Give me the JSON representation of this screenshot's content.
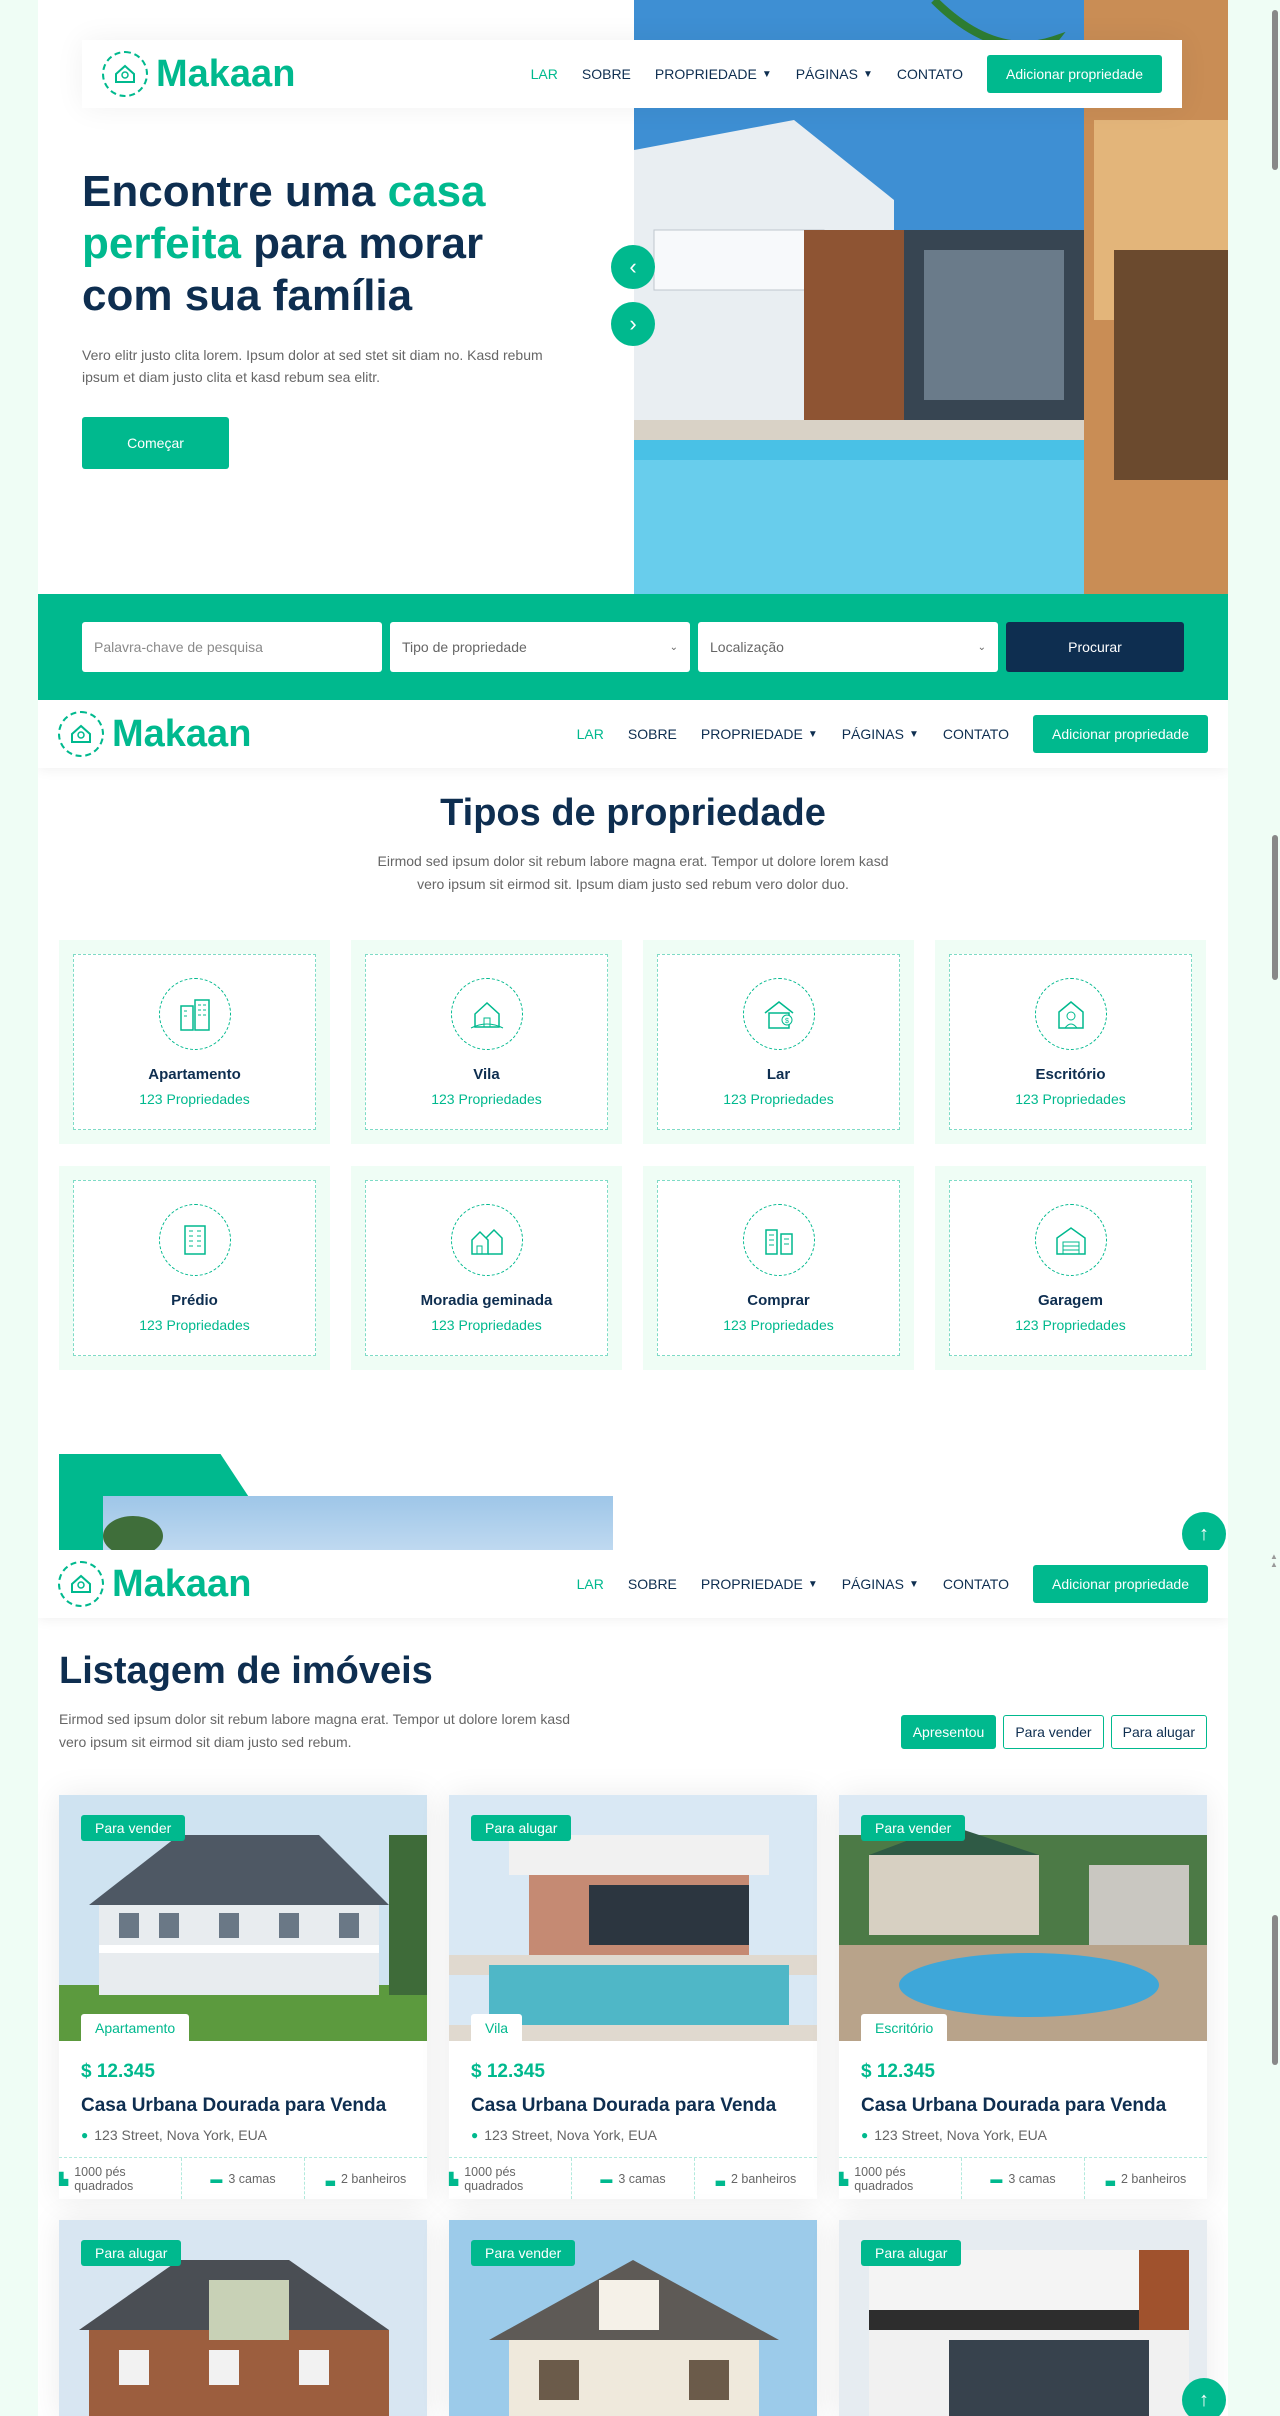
{
  "brand": {
    "name": "Makaan"
  },
  "nav": {
    "items": [
      {
        "label": "LAR"
      },
      {
        "label": "SOBRE"
      },
      {
        "label": "PROPRIEDADE"
      },
      {
        "label": "PÁGINAS"
      },
      {
        "label": "CONTATO"
      }
    ],
    "cta": "Adicionar propriedade"
  },
  "hero": {
    "title_part1": "Encontre uma ",
    "title_highlight1": "casa perfeita",
    "title_part2": " para morar com sua família",
    "text": "Vero elitr justo clita lorem. Ipsum dolor at sed stet sit diam no. Kasd rebum ipsum et diam justo clita et kasd rebum sea elitr.",
    "button": "Começar"
  },
  "search": {
    "keyword_placeholder": "Palavra-chave de pesquisa",
    "type_select": "Tipo de propriedade",
    "location_select": "Localização",
    "button": "Procurar"
  },
  "types_section": {
    "title": "Tipos de propriedade",
    "subtitle": "Eirmod sed ipsum dolor sit rebum labore magna erat. Tempor ut dolore lorem kasd vero ipsum sit eirmod sit. Ipsum diam justo sed rebum vero dolor duo.",
    "items": [
      {
        "name": "Apartamento",
        "count": "123 Propriedades",
        "icon": "apartment-icon"
      },
      {
        "name": "Vila",
        "count": "123 Propriedades",
        "icon": "villa-icon"
      },
      {
        "name": "Lar",
        "count": "123 Propriedades",
        "icon": "house-icon"
      },
      {
        "name": "Escritório",
        "count": "123 Propriedades",
        "icon": "office-icon"
      },
      {
        "name": "Prédio",
        "count": "123 Propriedades",
        "icon": "building-icon"
      },
      {
        "name": "Moradia geminada",
        "count": "123 Propriedades",
        "icon": "townhouse-icon"
      },
      {
        "name": "Comprar",
        "count": "123 Propriedades",
        "icon": "shop-icon"
      },
      {
        "name": "Garagem",
        "count": "123 Propriedades",
        "icon": "garage-icon"
      }
    ]
  },
  "listing_section": {
    "title": "Listagem de imóveis",
    "subtitle": "Eirmod sed ipsum dolor sit rebum labore magna erat. Tempor ut dolore lorem kasd vero ipsum sit eirmod sit diam justo sed rebum.",
    "filters": [
      "Apresentou",
      "Para vender",
      "Para alugar"
    ],
    "properties": [
      {
        "status": "Para vender",
        "type": "Apartamento",
        "price": "$ 12.345",
        "title": "Casa Urbana Dourada para Venda",
        "address": "123 Street, Nova York, EUA",
        "area": "1000 pés quadrados",
        "beds": "3 camas",
        "baths": "2 banheiros"
      },
      {
        "status": "Para alugar",
        "type": "Vila",
        "price": "$ 12.345",
        "title": "Casa Urbana Dourada para Venda",
        "address": "123 Street, Nova York, EUA",
        "area": "1000 pés quadrados",
        "beds": "3 camas",
        "baths": "2 banheiros"
      },
      {
        "status": "Para vender",
        "type": "Escritório",
        "price": "$ 12.345",
        "title": "Casa Urbana Dourada para Venda",
        "address": "123 Street, Nova York, EUA",
        "area": "1000 pés quadrados",
        "beds": "3 camas",
        "baths": "2 banheiros"
      },
      {
        "status": "Para alugar"
      },
      {
        "status": "Para vender"
      },
      {
        "status": "Para alugar"
      }
    ]
  },
  "colors": {
    "accent": "#00B98E",
    "dark": "#0E2E50",
    "light_bg": "#EFFDF5"
  }
}
